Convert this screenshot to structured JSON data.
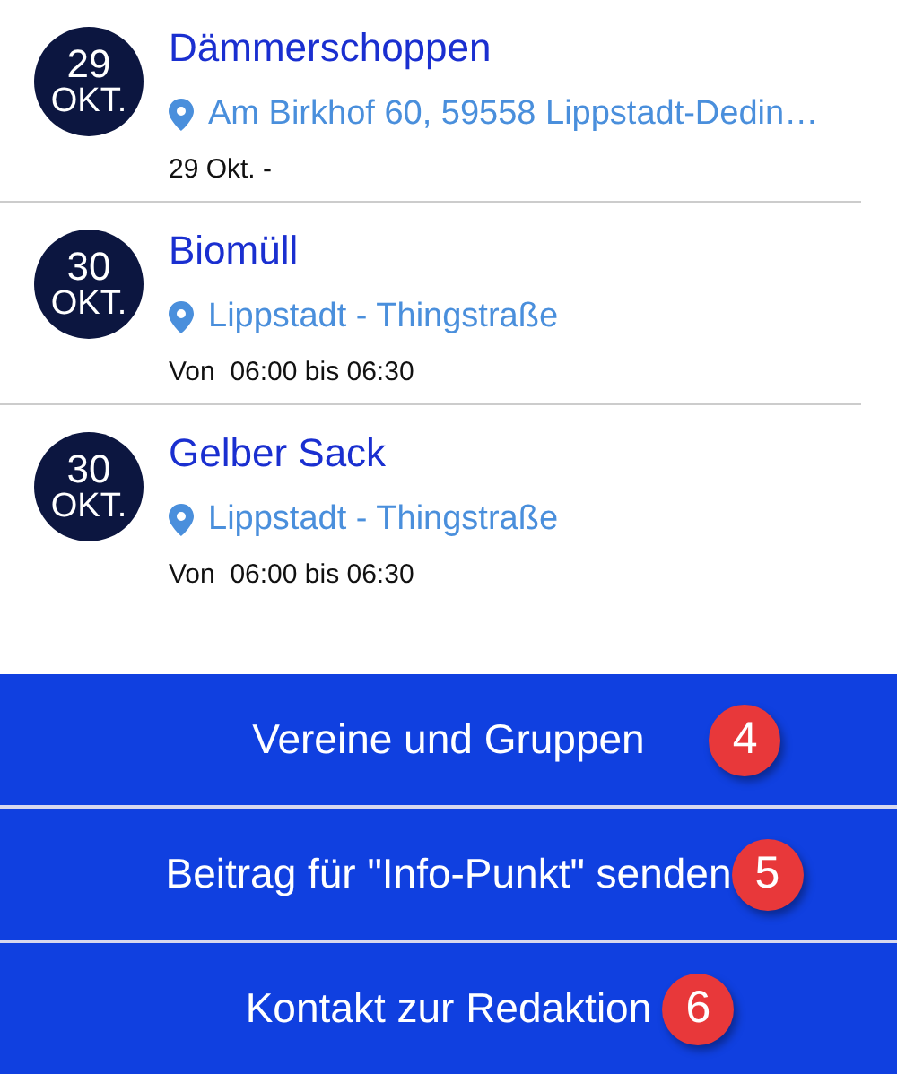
{
  "events": [
    {
      "day": "29",
      "month": "OKT.",
      "title": "Dämmerschoppen",
      "location": "Am Birkhof 60, 59558 Lippstadt-Dedin…",
      "time": "29 Okt. -"
    },
    {
      "day": "30",
      "month": "OKT.",
      "title": "Biomüll",
      "location": "Lippstadt - Thingstraße",
      "time": "Von  06:00 bis 06:30"
    },
    {
      "day": "30",
      "month": "OKT.",
      "title": "Gelber Sack",
      "location": "Lippstadt - Thingstraße",
      "time": "Von  06:00 bis 06:30"
    }
  ],
  "menu": [
    {
      "label": "Vereine und Gruppen",
      "badge": "4"
    },
    {
      "label": "Beitrag für \"Info-Punkt\" senden",
      "badge": "5"
    },
    {
      "label": "Kontakt zur Redaktion",
      "badge": "6"
    }
  ]
}
